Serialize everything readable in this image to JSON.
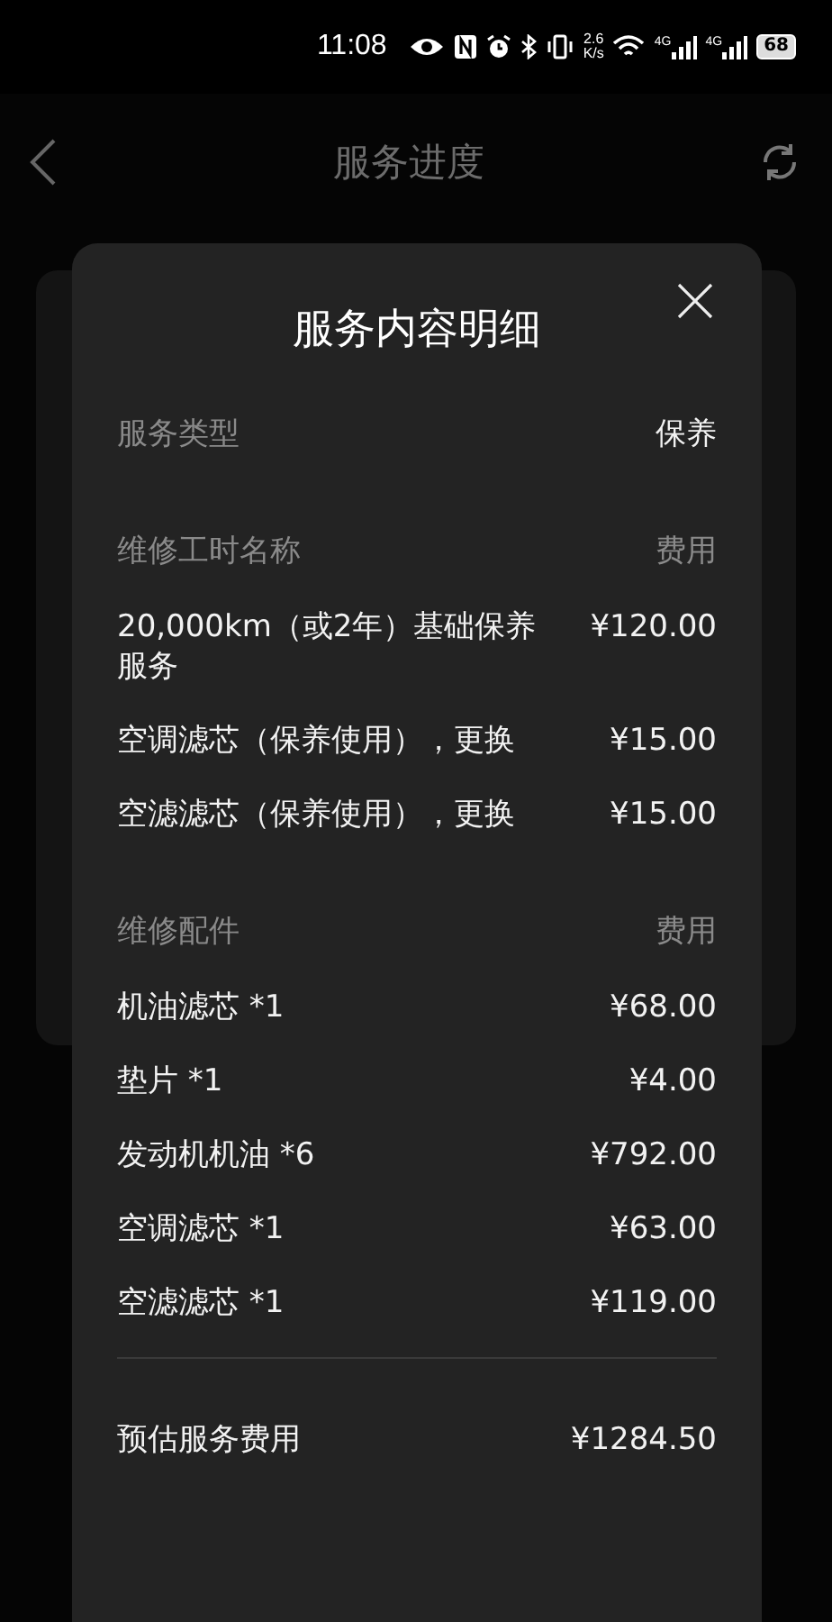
{
  "status_bar": {
    "time": "11:08",
    "speed_value": "2.6",
    "speed_unit": "K/s",
    "network_1": "4G",
    "network_2": "4G",
    "battery": "68"
  },
  "header": {
    "title": "服务进度"
  },
  "dialog": {
    "title": "服务内容明细",
    "service_type": {
      "label": "服务类型",
      "value": "保养"
    },
    "sections": [
      {
        "heading": "维修工时名称",
        "fee_heading": "费用",
        "items": [
          {
            "name": "20,000km（或2年）基础保养服务",
            "price": "¥120.00"
          },
          {
            "name": "空调滤芯（保养使用），更换",
            "price": "¥15.00"
          },
          {
            "name": "空滤滤芯（保养使用），更换",
            "price": "¥15.00"
          }
        ]
      },
      {
        "heading": "维修配件",
        "fee_heading": "费用",
        "items": [
          {
            "name": "机油滤芯 *1",
            "price": "¥68.00"
          },
          {
            "name": "垫片 *1",
            "price": "¥4.00"
          },
          {
            "name": "发动机机油 *6",
            "price": "¥792.00"
          },
          {
            "name": "空调滤芯 *1",
            "price": "¥63.00"
          },
          {
            "name": "空滤滤芯 *1",
            "price": "¥119.00"
          }
        ]
      }
    ],
    "total": {
      "label": "预估服务费用",
      "value": "¥1284.50"
    }
  }
}
